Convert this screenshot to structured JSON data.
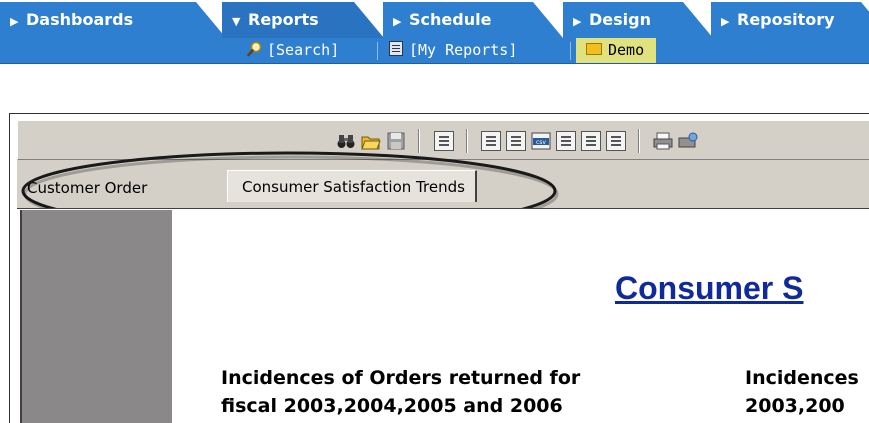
{
  "nav": {
    "tabs": [
      {
        "label": "Dashboards",
        "icon": "triangle-right"
      },
      {
        "label": "Reports",
        "icon": "triangle-down",
        "active": true
      },
      {
        "label": "Schedule",
        "icon": "triangle-right"
      },
      {
        "label": "Design",
        "icon": "triangle-right"
      },
      {
        "label": "Repository",
        "icon": "triangle-right"
      }
    ],
    "subitems": {
      "search": "[Search]",
      "my_reports": "[My Reports]",
      "demo": "Demo"
    }
  },
  "report_tabs": {
    "customer": "Customer Order",
    "consumer": "Consumer Satisfaction Trends"
  },
  "report": {
    "title": "Consumer S",
    "left_text_line1": "Incidences of Orders returned for",
    "left_text_line2": "fiscal  2003,2004,2005 and 2006",
    "right_text_line1": "Incidences",
    "right_text_line2": "2003,200"
  },
  "colors": {
    "nav_blue": "#2f7fd1",
    "demo_highlight": "#e1e27d",
    "title_blue": "#102a9c",
    "toolbar_gray": "#d4d0c8"
  }
}
